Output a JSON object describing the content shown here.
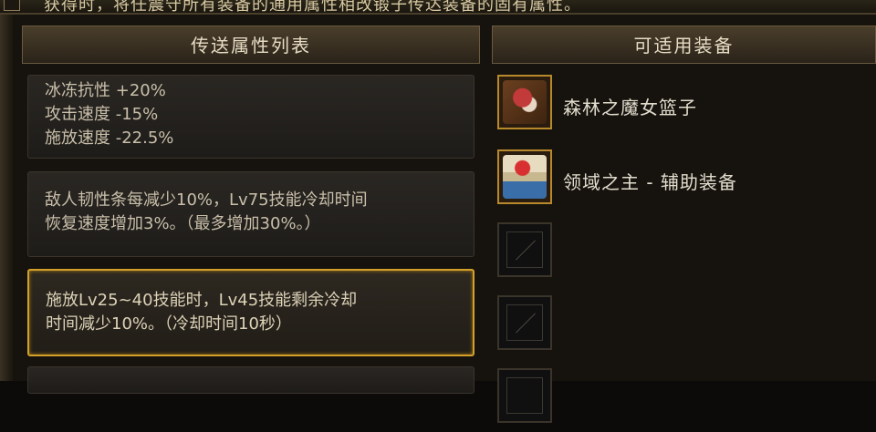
{
  "top_banner": {
    "text": "获得时，将任震守所有装备的通用属性相改锻子传达装备的固有属性。"
  },
  "left_panel": {
    "title": "传送属性列表",
    "stats": [
      {
        "name": "冰冻抗性",
        "value": "+20%"
      },
      {
        "name": "攻击速度",
        "value": "-15%"
      },
      {
        "name": "施放速度",
        "value": "-22.5%"
      }
    ],
    "effects": [
      {
        "lines": [
          "敌人韧性条每减少10%，Lv75技能冷却时间",
          "恢复速度增加3%。（最多增加30%。）"
        ],
        "selected": false
      },
      {
        "lines": [
          "施放Lv25~40技能时，Lv45技能剩余冷却",
          "时间减少10%。（冷却时间10秒）"
        ],
        "selected": true
      }
    ]
  },
  "right_panel": {
    "title": "可适用装备",
    "items": [
      {
        "name": "森林之魔女篮子",
        "icon": "witch-basket-icon"
      },
      {
        "name": "领域之主 - 辅助装备",
        "icon": "domain-lord-scroll-icon"
      },
      {
        "name": "",
        "icon": "empty-slot-icon"
      },
      {
        "name": "",
        "icon": "empty-slot-icon"
      },
      {
        "name": "",
        "icon": "empty-slot-icon"
      }
    ]
  },
  "colors": {
    "accent": "#d4a02a",
    "panel_bg": "#16130e",
    "text": "#c9bfaa"
  }
}
